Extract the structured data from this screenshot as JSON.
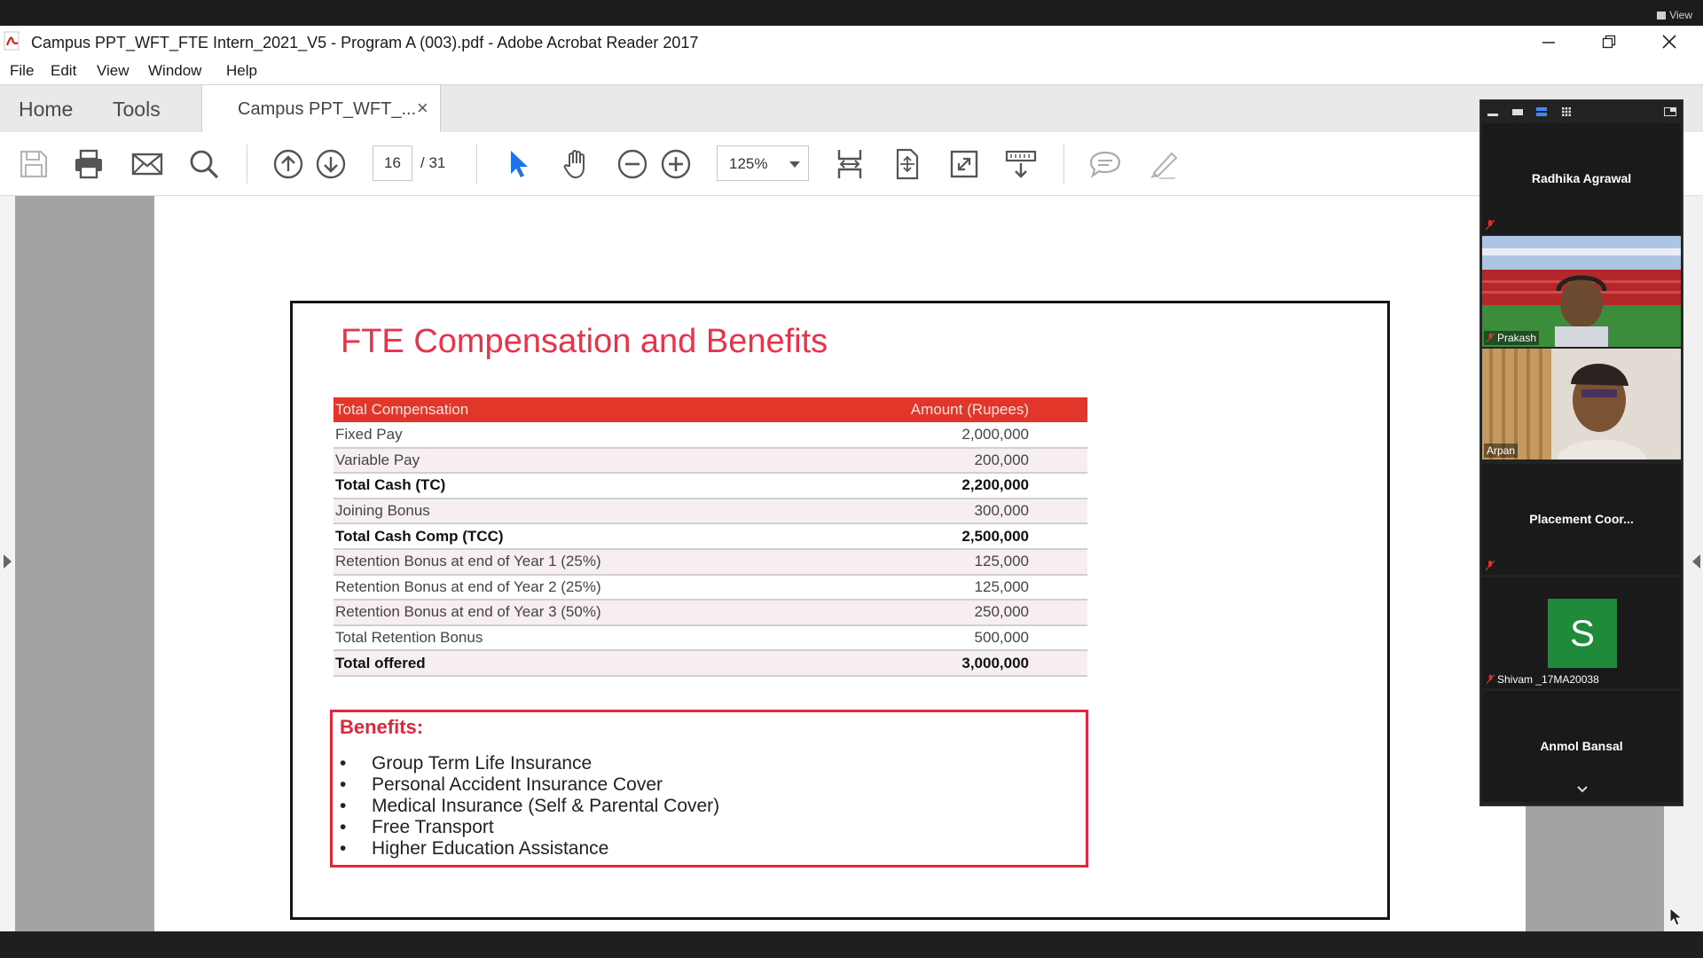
{
  "share_bar": {
    "view_label": "View"
  },
  "window": {
    "title": "Campus PPT_WFT_FTE Intern_2021_V5 - Program A (003).pdf - Adobe Acrobat Reader 2017"
  },
  "menu": {
    "items": [
      "File",
      "Edit",
      "View",
      "Window",
      "Help"
    ]
  },
  "tabs": {
    "home": "Home",
    "tools": "Tools",
    "doc_tab": "Campus PPT_WFT_...",
    "close_glyph": "×"
  },
  "toolbar": {
    "page_current": "16",
    "page_total": "/ 31",
    "zoom": "125%",
    "icons": [
      "save-icon",
      "print-icon",
      "email-icon",
      "search-icon",
      "prev-page-icon",
      "next-page-icon",
      "select-cursor-icon",
      "hand-icon",
      "zoom-out-icon",
      "zoom-in-icon",
      "fit-width-icon",
      "fit-page-icon",
      "fullscreen-icon",
      "read-mode-icon",
      "comment-icon",
      "highlight-icon"
    ]
  },
  "slide": {
    "title": "FTE Compensation and Benefits",
    "table": {
      "headers": [
        "Total Compensation",
        "Amount (Rupees)"
      ],
      "rows": [
        {
          "label": "Fixed Pay",
          "amount": "2,000,000",
          "bold": false
        },
        {
          "label": "Variable Pay",
          "amount": "200,000",
          "bold": false
        },
        {
          "label": "Total Cash (TC)",
          "amount": "2,200,000",
          "bold": true
        },
        {
          "label": "Joining Bonus",
          "amount": "300,000",
          "bold": false
        },
        {
          "label": "Total Cash Comp (TCC)",
          "amount": "2,500,000",
          "bold": true
        },
        {
          "label": "Retention Bonus at end of Year 1 (25%)",
          "amount": "125,000",
          "bold": false
        },
        {
          "label": "Retention Bonus at end of Year 2 (25%)",
          "amount": "125,000",
          "bold": false
        },
        {
          "label": "Retention Bonus at end of Year 3 (50%)",
          "amount": "250,000",
          "bold": false
        },
        {
          "label": "Total Retention Bonus",
          "amount": "500,000",
          "bold": false
        },
        {
          "label": "Total offered",
          "amount": "3,000,000",
          "bold": true
        }
      ]
    },
    "benefits": {
      "heading": "Benefits:",
      "bullet": "•",
      "items": [
        "Group Term Life Insurance",
        "Personal Accident Insurance Cover",
        "Medical Insurance (Self & Parental Cover)",
        "Free Transport",
        "Higher Education Assistance"
      ]
    }
  },
  "zoom_panel": {
    "participants": [
      {
        "name": "Radhika Agrawal",
        "video": false,
        "muted": true
      },
      {
        "name": "Prakash",
        "video": true,
        "muted": true
      },
      {
        "name": "Arpan",
        "video": true,
        "muted": false
      },
      {
        "name": "Placement  Coor...",
        "video": false,
        "muted": true
      },
      {
        "name": "Shivam _17MA20038",
        "video": false,
        "avatar_letter": "S",
        "muted": true
      },
      {
        "name": "Anmol Bansal",
        "video": false,
        "muted": false
      }
    ]
  },
  "colors": {
    "accent_red": "#e2362a",
    "title_red": "#e8334a",
    "benefits_border": "#e0283c",
    "select_blue": "#1e73e8",
    "avatar_green": "#1e8a3a"
  }
}
